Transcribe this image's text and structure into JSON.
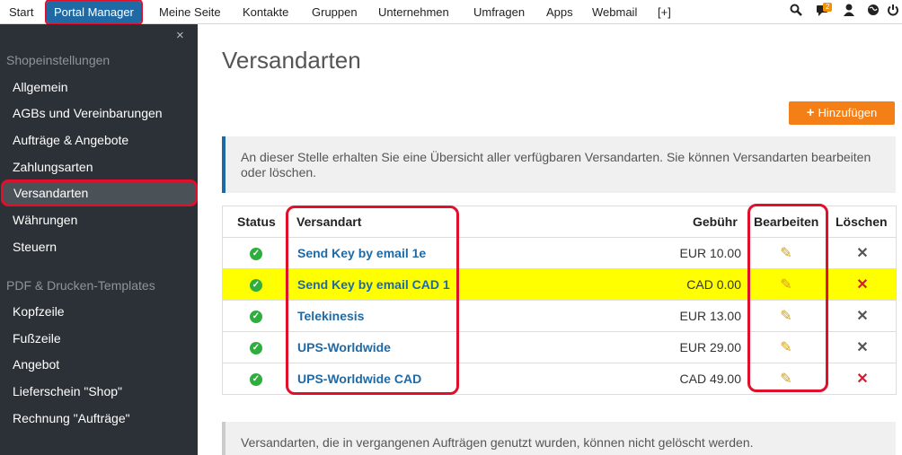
{
  "topnav": {
    "items": [
      "Start",
      "Portal Manager",
      "Meine Seite",
      "Kontakte",
      "Gruppen",
      "Unternehmen",
      "Umfragen",
      "Apps",
      "Webmail",
      "[+]"
    ],
    "badge_count": "2",
    "icons": [
      "search-icon",
      "chat-icon",
      "user-icon",
      "globe-icon",
      "power-icon"
    ]
  },
  "sidebar": {
    "close": "×",
    "section1": "Shopeinstellungen",
    "items1": [
      "Allgemein",
      "AGBs und Vereinbarungen",
      "Aufträge & Angebote",
      "Zahlungsarten",
      "Versandarten",
      "Währungen",
      "Steuern"
    ],
    "section2": "PDF & Drucken-Templates",
    "items2": [
      "Kopfzeile",
      "Fußzeile",
      "Angebot",
      "Lieferschein \"Shop\"",
      "Rechnung \"Aufträge\""
    ]
  },
  "main": {
    "title": "Versandarten",
    "add_button": "Hinzufügen",
    "info": "An dieser Stelle erhalten Sie eine Übersicht aller verfügbaren Versandarten. Sie können Versandarten bearbeiten oder löschen.",
    "note": "Versandarten, die in vergangenen Aufträgen genutzt wurden, können nicht gelöscht werden."
  },
  "table": {
    "headers": {
      "status": "Status",
      "name": "Versandart",
      "fee": "Gebühr",
      "edit": "Bearbeiten",
      "delete": "Löschen"
    },
    "rows": [
      {
        "name": "Send Key by email 1e",
        "fee": "EUR 10.00"
      },
      {
        "name": "Send Key by email CAD 1",
        "fee": "CAD 0.00"
      },
      {
        "name": "Telekinesis",
        "fee": "EUR 13.00"
      },
      {
        "name": "UPS-Worldwide",
        "fee": "EUR 29.00"
      },
      {
        "name": "UPS-Worldwide CAD",
        "fee": "CAD 49.00"
      }
    ]
  },
  "colors": {
    "accent": "#1f6aa5",
    "button": "#f47f16",
    "highlight": "#ffff00",
    "annotation": "#e0102a"
  }
}
